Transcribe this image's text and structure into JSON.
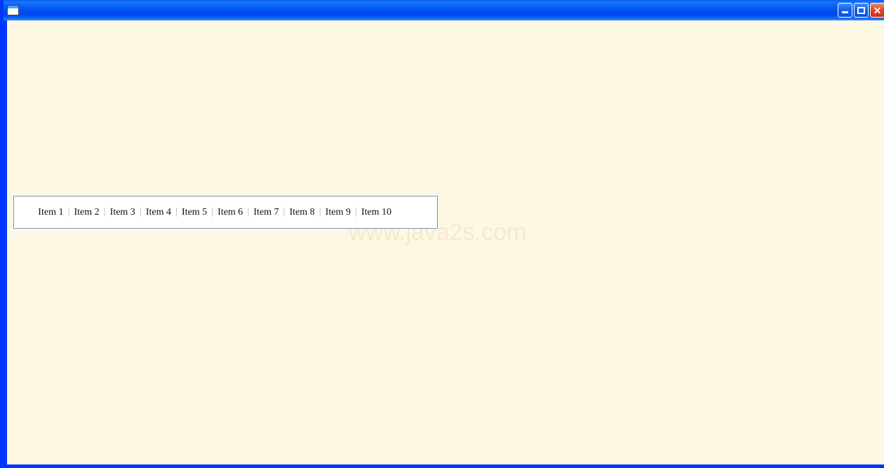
{
  "window": {
    "title": "",
    "icon": "application-window-icon",
    "frame_color": "#0037ff",
    "client_background": "#fdf8e3",
    "titlebar_color": "#0050f2"
  },
  "titlebar": {
    "minimize_label": "",
    "maximize_label": "",
    "close_label": "✕",
    "minimize_name": "minimize-button",
    "maximize_name": "maximize-button",
    "close_name": "close-button"
  },
  "watermark": {
    "text": "www.java2s.com",
    "color": "#f2ead0"
  },
  "item_panel": {
    "background": "#ffffff",
    "border_color": "#7b96b8",
    "separator": "|",
    "items": [
      {
        "label": "Item 1"
      },
      {
        "label": "Item 2"
      },
      {
        "label": "Item 3"
      },
      {
        "label": "Item 4"
      },
      {
        "label": "Item 5"
      },
      {
        "label": "Item 6"
      },
      {
        "label": "Item 7"
      },
      {
        "label": "Item 8"
      },
      {
        "label": "Item 9"
      },
      {
        "label": "Item 10"
      }
    ]
  }
}
